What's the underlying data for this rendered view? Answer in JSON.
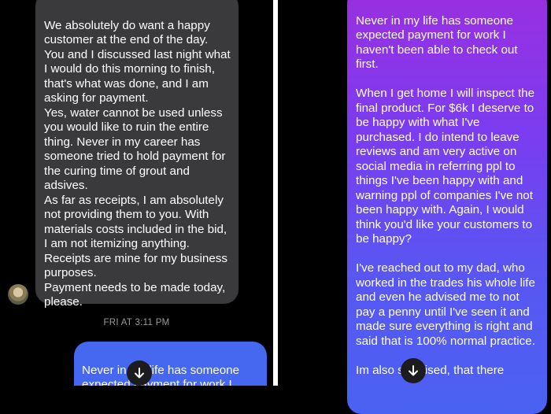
{
  "left_screen": {
    "received_message": "We absolutely do want a happy customer at the end of the day. You and I discussed last night what I would do this morning to finish, that's what was done, and I am asking for payment.\nYes, water cannot be used unless you would like to ruin the entire thing. Never in my career has someone tried to hold payment for the curing time of grout and adsives.\nAs far as receipts, I am absolutely not providing them to you. With materials costs included in the bid, I am not itemizing anything.\nReceipts are mine for my business purposes.\nPayment needs to be made today, please.",
    "timestamp": "FRI AT 3:11 PM",
    "sent_message_preview": "Never in my life has someone expected payment for work I haven't been able to check out"
  },
  "right_screen": {
    "sent_message": "Never in my life has someone expected payment for work I haven't been able to check out first.\n\nWhen I get home I will inspect the final product. For $6k I deserve to be happy with what I've purchased. I do intend to leave reviews and am very active on social media in referring ppl to things I've been happy with and warning ppl of companies I've not been happy with. Again, I would think you'd like your customers to be happy?\n\n I've reached out to my dad, who worked in the trades his whole life and even he advised me to not pay a penny until I've seen it and made sure everything is right and said that is 100% normal practice.\n\nIm also surprised, that there"
  },
  "icons": {
    "scroll_down": "arrow-down-icon",
    "avatar": "contact-avatar"
  },
  "colors": {
    "received_bubble": "#3a3a3c",
    "sent_bubble_blue": "#4667f0",
    "sent_gradient_top": "#9a2fe0",
    "sent_gradient_bottom": "#4a62f2"
  }
}
